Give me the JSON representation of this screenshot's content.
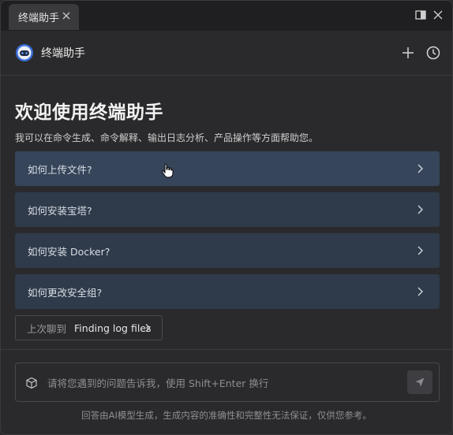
{
  "tab": {
    "title": "终端助手"
  },
  "header": {
    "title": "终端助手"
  },
  "main": {
    "title": "欢迎使用终端助手",
    "subtitle": "我可以在命令生成、命令解释、输出日志分析、产品操作等方面帮助您。",
    "suggestions": [
      {
        "label": "如何上传文件?"
      },
      {
        "label": "如何安装宝塔?"
      },
      {
        "label": "如何安装 Docker?"
      },
      {
        "label": "如何更改安全组?"
      }
    ]
  },
  "last_chat": {
    "prefix": "上次聊到",
    "topic": "Finding log files"
  },
  "input": {
    "placeholder": "请将您遇到的问题告诉我，使用 Shift+Enter 换行",
    "value": ""
  },
  "footer": {
    "disclaimer": "回答由AI模型生成，生成内容的准确性和完整性无法保证，仅供您参考。"
  },
  "icons": {
    "tab_close": "close-icon",
    "panel_toggle": "panel-layout-icon",
    "window_close": "close-icon",
    "logo": "assistant-robot-icon",
    "new_chat": "plus-icon",
    "history": "clock-icon",
    "suggestion_arrow": "chevron-right-icon",
    "input_prefix": "cube-icon",
    "send": "send-icon"
  },
  "colors": {
    "background": "#2a2a2c",
    "suggestion_bg": "#2f3a4a",
    "suggestion_hover_bg": "#36455a",
    "accent_logo": "#3b6fd8"
  }
}
